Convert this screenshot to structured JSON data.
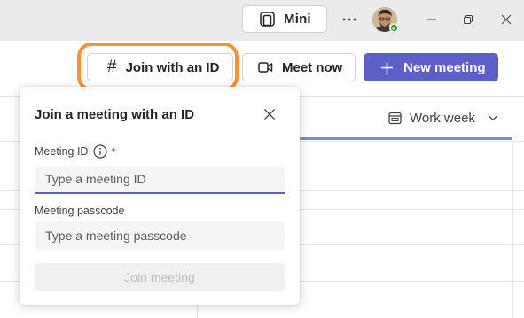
{
  "titlebar": {
    "mini_label": "Mini",
    "more_icon": "more-horizontal-icon",
    "minimize_icon": "minimize-icon",
    "restore_icon": "restore-icon",
    "close_icon": "close-icon"
  },
  "toolbar": {
    "join_id_label": "Join with an ID",
    "meet_now_label": "Meet now",
    "new_meeting_label": "New meeting",
    "highlight_color": "#f7923a",
    "primary_color": "#5b5fc7"
  },
  "calendar": {
    "view_label": "Work week"
  },
  "flyout": {
    "title": "Join a meeting with an ID",
    "meeting_id_label": "Meeting ID",
    "required_mark": "*",
    "meeting_id_placeholder": "Type a meeting ID",
    "passcode_label": "Meeting passcode",
    "passcode_placeholder": "Type a meeting passcode",
    "join_button_label": "Join meeting"
  }
}
